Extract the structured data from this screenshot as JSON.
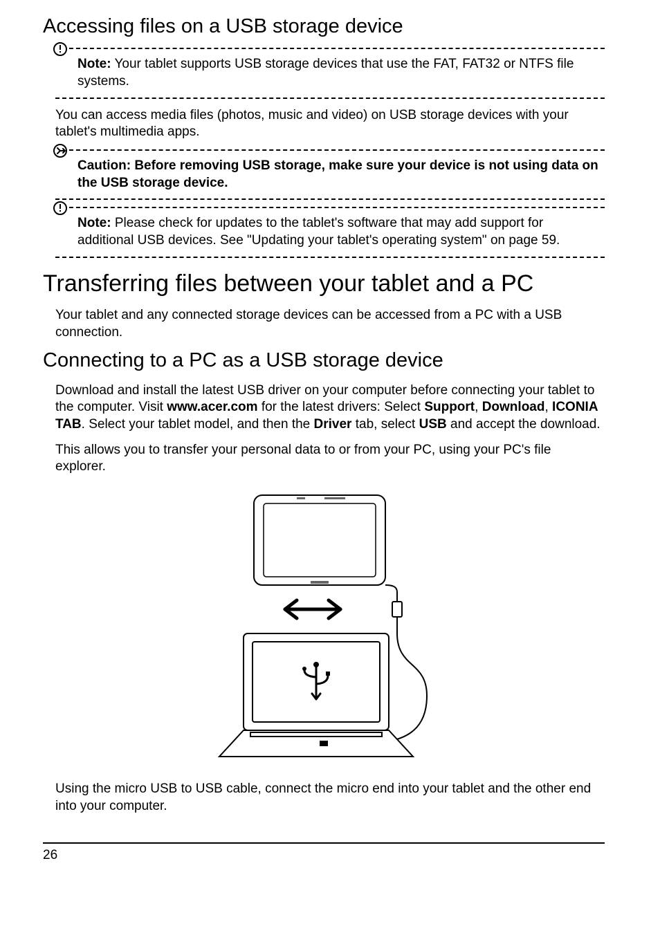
{
  "headings": {
    "accessing": "Accessing files on a USB storage device",
    "transferring": "Transferring files between your tablet and a PC",
    "connecting": "Connecting to a PC as a USB storage device"
  },
  "notes": {
    "n1_label": "Note:",
    "n1_text": " Your tablet supports USB storage devices that use the FAT, FAT32 or NTFS file systems.",
    "c1_text": "Caution: Before removing USB storage, make sure your device is not using data on the USB storage device.",
    "n2_label": "Note:",
    "n2_text": " Please check for updates to the tablet's software that may add support for additional USB devices. See \"Updating your tablet's operating system\" on page 59."
  },
  "paras": {
    "p1": "You can access media files (photos, music and video) on USB storage devices with your tablet's multimedia apps.",
    "p2": "Your tablet and any connected storage devices can be accessed from a PC with a USB connection.",
    "p3a": "Download and install the latest USB driver on your computer before connecting your tablet to the computer. Visit ",
    "p3b": "www.acer.com",
    "p3c": " for the latest drivers: Select ",
    "p3d": "Support",
    "p3e": ", ",
    "p3f": "Download",
    "p3g": ", ",
    "p3h": "ICONIA TAB",
    "p3i": ". Select your tablet model, and then the ",
    "p3j": "Driver",
    "p3k": " tab, select ",
    "p3l": "USB",
    "p3m": " and accept the download.",
    "p4": "This allows you to transfer your personal data to or from your PC, using your PC's file explorer.",
    "p5": "Using the micro USB to USB cable, connect the micro end into your tablet and the other end into your computer."
  },
  "page_number": "26"
}
